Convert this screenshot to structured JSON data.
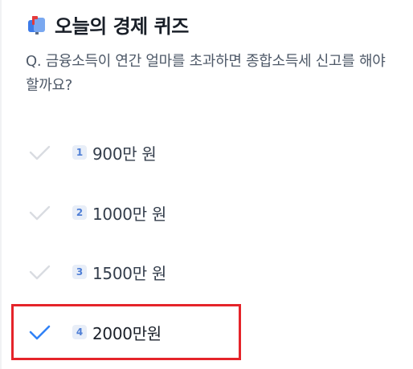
{
  "header": {
    "icon": "mailbox-icon",
    "title": "오늘의 경제 퀴즈"
  },
  "question": {
    "text": "Q. 금융소득이 연간 얼마를 초과하면 종합소득세 신고를 해야 할까요?"
  },
  "options": [
    {
      "number": "1",
      "label": "900만 원",
      "selected": false
    },
    {
      "number": "2",
      "label": "1000만 원",
      "selected": false
    },
    {
      "number": "3",
      "label": "1500만 원",
      "selected": false
    },
    {
      "number": "4",
      "label": "2000만원",
      "selected": true
    }
  ],
  "colors": {
    "check_inactive": "#d9dce1",
    "check_active": "#3182f6",
    "highlight_border": "#e5242a",
    "number_badge_bg": "#e8eef8",
    "number_badge_text": "#4f7fd6"
  }
}
